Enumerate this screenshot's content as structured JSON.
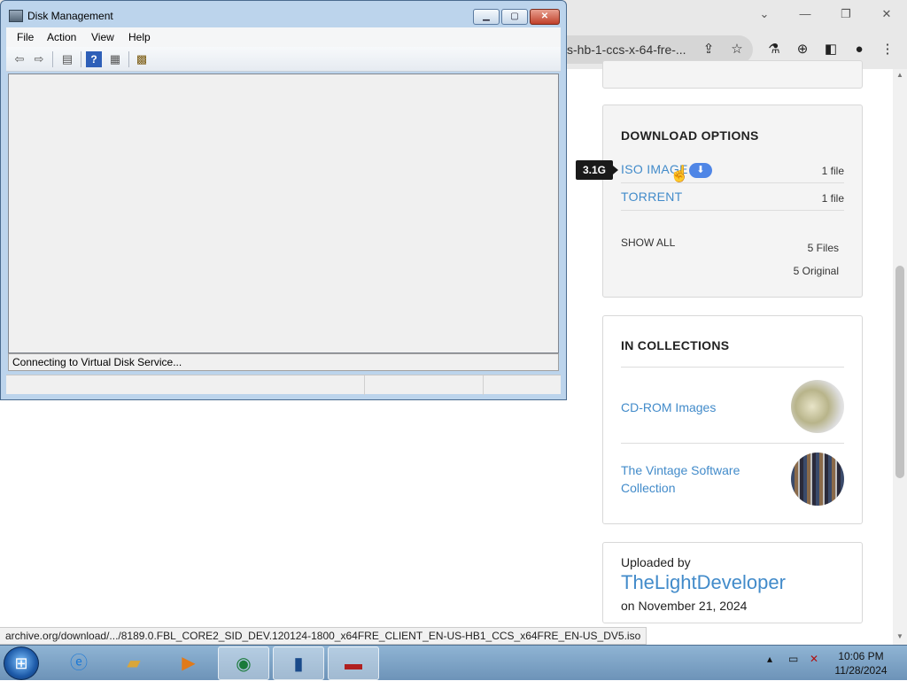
{
  "browser": {
    "window_controls": {
      "tabs_dropdown": "⌄",
      "minimize": "—",
      "restore": "❐",
      "close": "✕"
    },
    "address_bar_text": "s-hb-1-ccs-x-64-fre-...",
    "status_url": "archive.org/download/.../8189.0.FBL_CORE2_SID_DEV.120124-1800_x64FRE_CLIENT_EN-US-HB1_CCS_x64FRE_EN-US_DV5.iso"
  },
  "page": {
    "download_options": {
      "title": "DOWNLOAD OPTIONS",
      "tooltip": "3.1G",
      "rows": [
        {
          "label": "ISO IMAGE",
          "count": "1 file"
        },
        {
          "label": "TORRENT",
          "count": "1 file"
        }
      ],
      "show_all": "SHOW ALL",
      "files_count": "5 Files",
      "original_count": "5 Original"
    },
    "collections": {
      "title": "IN COLLECTIONS",
      "items": [
        {
          "label": "CD-ROM Images"
        },
        {
          "label": "The Vintage Software Collection"
        }
      ]
    },
    "uploader": {
      "label": "Uploaded by",
      "name": "TheLightDeveloper",
      "date": "on November 21, 2024"
    }
  },
  "disk_management": {
    "title": "Disk Management",
    "menu": [
      "File",
      "Action",
      "View",
      "Help"
    ],
    "status": "Connecting to Virtual Disk Service..."
  },
  "taskbar": {
    "time": "10:06 PM",
    "date": "11/28/2024"
  },
  "colors": {
    "link": "#428bca",
    "badge": "#4f86e6"
  }
}
